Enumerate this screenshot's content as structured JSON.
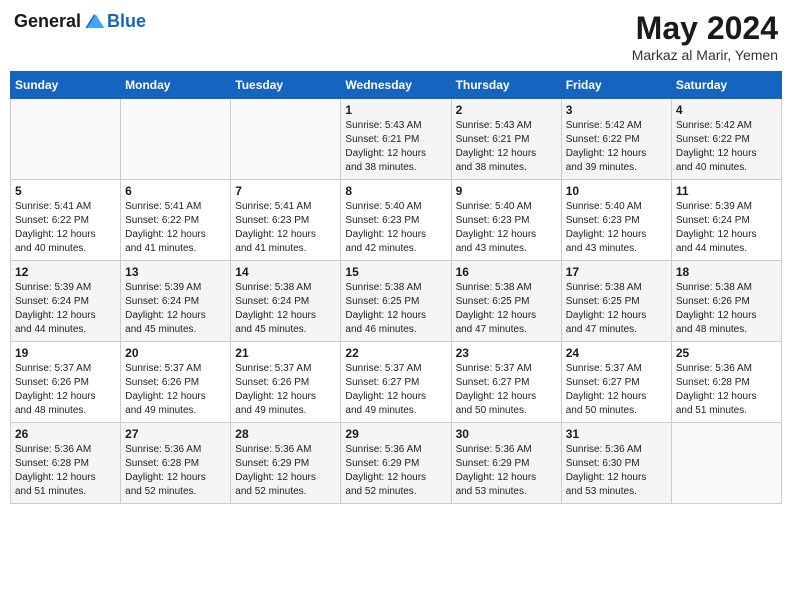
{
  "header": {
    "logo_line1": "General",
    "logo_line2": "Blue",
    "month_year": "May 2024",
    "location": "Markaz al Marir, Yemen"
  },
  "days_of_week": [
    "Sunday",
    "Monday",
    "Tuesday",
    "Wednesday",
    "Thursday",
    "Friday",
    "Saturday"
  ],
  "weeks": [
    [
      {
        "day": "",
        "info": ""
      },
      {
        "day": "",
        "info": ""
      },
      {
        "day": "",
        "info": ""
      },
      {
        "day": "1",
        "info": "Sunrise: 5:43 AM\nSunset: 6:21 PM\nDaylight: 12 hours\nand 38 minutes."
      },
      {
        "day": "2",
        "info": "Sunrise: 5:43 AM\nSunset: 6:21 PM\nDaylight: 12 hours\nand 38 minutes."
      },
      {
        "day": "3",
        "info": "Sunrise: 5:42 AM\nSunset: 6:22 PM\nDaylight: 12 hours\nand 39 minutes."
      },
      {
        "day": "4",
        "info": "Sunrise: 5:42 AM\nSunset: 6:22 PM\nDaylight: 12 hours\nand 40 minutes."
      }
    ],
    [
      {
        "day": "5",
        "info": "Sunrise: 5:41 AM\nSunset: 6:22 PM\nDaylight: 12 hours\nand 40 minutes."
      },
      {
        "day": "6",
        "info": "Sunrise: 5:41 AM\nSunset: 6:22 PM\nDaylight: 12 hours\nand 41 minutes."
      },
      {
        "day": "7",
        "info": "Sunrise: 5:41 AM\nSunset: 6:23 PM\nDaylight: 12 hours\nand 41 minutes."
      },
      {
        "day": "8",
        "info": "Sunrise: 5:40 AM\nSunset: 6:23 PM\nDaylight: 12 hours\nand 42 minutes."
      },
      {
        "day": "9",
        "info": "Sunrise: 5:40 AM\nSunset: 6:23 PM\nDaylight: 12 hours\nand 43 minutes."
      },
      {
        "day": "10",
        "info": "Sunrise: 5:40 AM\nSunset: 6:23 PM\nDaylight: 12 hours\nand 43 minutes."
      },
      {
        "day": "11",
        "info": "Sunrise: 5:39 AM\nSunset: 6:24 PM\nDaylight: 12 hours\nand 44 minutes."
      }
    ],
    [
      {
        "day": "12",
        "info": "Sunrise: 5:39 AM\nSunset: 6:24 PM\nDaylight: 12 hours\nand 44 minutes."
      },
      {
        "day": "13",
        "info": "Sunrise: 5:39 AM\nSunset: 6:24 PM\nDaylight: 12 hours\nand 45 minutes."
      },
      {
        "day": "14",
        "info": "Sunrise: 5:38 AM\nSunset: 6:24 PM\nDaylight: 12 hours\nand 45 minutes."
      },
      {
        "day": "15",
        "info": "Sunrise: 5:38 AM\nSunset: 6:25 PM\nDaylight: 12 hours\nand 46 minutes."
      },
      {
        "day": "16",
        "info": "Sunrise: 5:38 AM\nSunset: 6:25 PM\nDaylight: 12 hours\nand 47 minutes."
      },
      {
        "day": "17",
        "info": "Sunrise: 5:38 AM\nSunset: 6:25 PM\nDaylight: 12 hours\nand 47 minutes."
      },
      {
        "day": "18",
        "info": "Sunrise: 5:38 AM\nSunset: 6:26 PM\nDaylight: 12 hours\nand 48 minutes."
      }
    ],
    [
      {
        "day": "19",
        "info": "Sunrise: 5:37 AM\nSunset: 6:26 PM\nDaylight: 12 hours\nand 48 minutes."
      },
      {
        "day": "20",
        "info": "Sunrise: 5:37 AM\nSunset: 6:26 PM\nDaylight: 12 hours\nand 49 minutes."
      },
      {
        "day": "21",
        "info": "Sunrise: 5:37 AM\nSunset: 6:26 PM\nDaylight: 12 hours\nand 49 minutes."
      },
      {
        "day": "22",
        "info": "Sunrise: 5:37 AM\nSunset: 6:27 PM\nDaylight: 12 hours\nand 49 minutes."
      },
      {
        "day": "23",
        "info": "Sunrise: 5:37 AM\nSunset: 6:27 PM\nDaylight: 12 hours\nand 50 minutes."
      },
      {
        "day": "24",
        "info": "Sunrise: 5:37 AM\nSunset: 6:27 PM\nDaylight: 12 hours\nand 50 minutes."
      },
      {
        "day": "25",
        "info": "Sunrise: 5:36 AM\nSunset: 6:28 PM\nDaylight: 12 hours\nand 51 minutes."
      }
    ],
    [
      {
        "day": "26",
        "info": "Sunrise: 5:36 AM\nSunset: 6:28 PM\nDaylight: 12 hours\nand 51 minutes."
      },
      {
        "day": "27",
        "info": "Sunrise: 5:36 AM\nSunset: 6:28 PM\nDaylight: 12 hours\nand 52 minutes."
      },
      {
        "day": "28",
        "info": "Sunrise: 5:36 AM\nSunset: 6:29 PM\nDaylight: 12 hours\nand 52 minutes."
      },
      {
        "day": "29",
        "info": "Sunrise: 5:36 AM\nSunset: 6:29 PM\nDaylight: 12 hours\nand 52 minutes."
      },
      {
        "day": "30",
        "info": "Sunrise: 5:36 AM\nSunset: 6:29 PM\nDaylight: 12 hours\nand 53 minutes."
      },
      {
        "day": "31",
        "info": "Sunrise: 5:36 AM\nSunset: 6:30 PM\nDaylight: 12 hours\nand 53 minutes."
      },
      {
        "day": "",
        "info": ""
      }
    ]
  ]
}
